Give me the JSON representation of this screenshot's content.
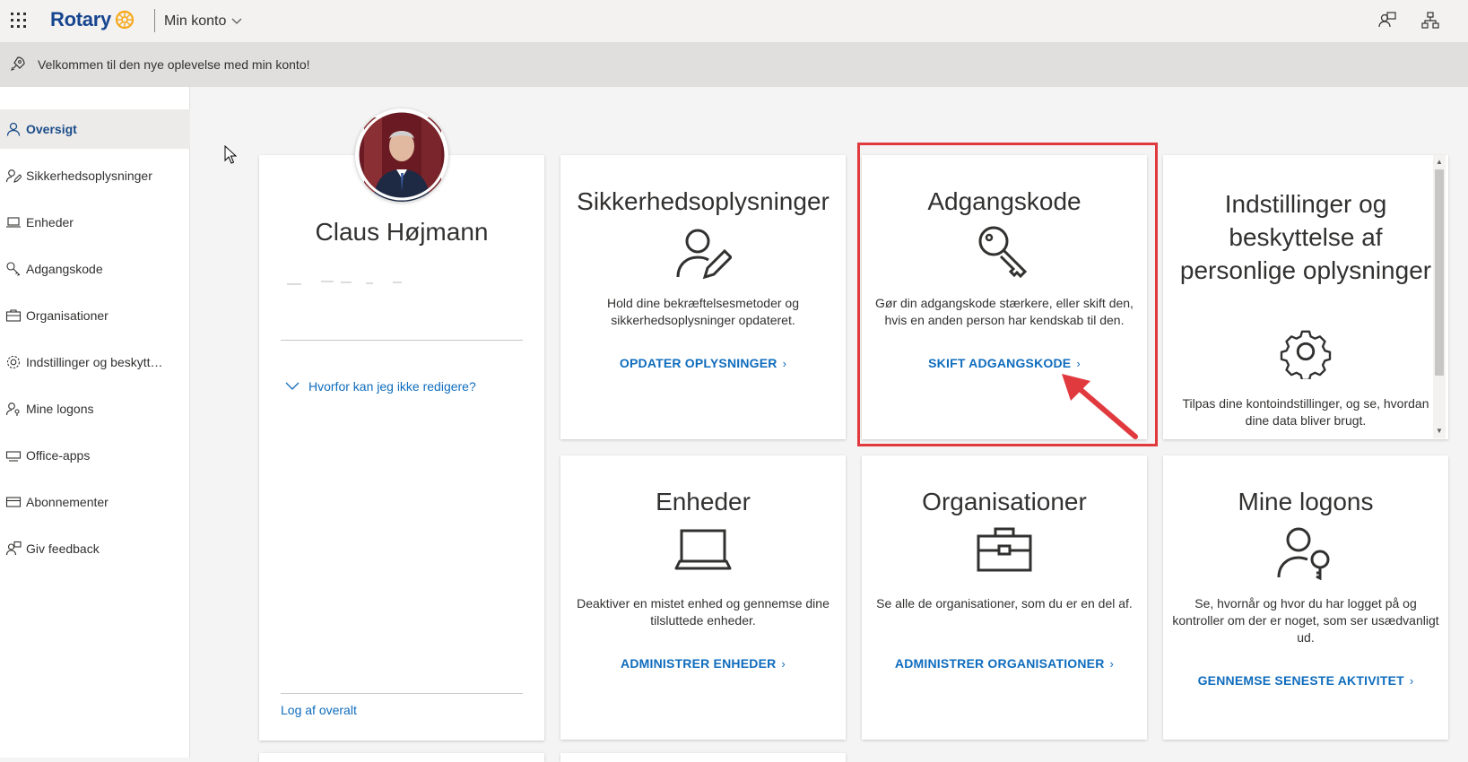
{
  "topbar": {
    "brand": "Rotary",
    "app_title": "Min konto",
    "icons": [
      "waffle-icon",
      "rotary-wheel-icon",
      "chevron-down-icon",
      "feedback-icon",
      "org-chart-icon"
    ]
  },
  "banner": {
    "text": "Velkommen til den nye oplevelse med min konto!",
    "icon": "rocket-icon"
  },
  "sidebar": {
    "items": [
      {
        "label": "Oversigt",
        "icon": "person-icon",
        "active": true
      },
      {
        "label": "Sikkerhedsoplysninger",
        "icon": "person-edit-icon"
      },
      {
        "label": "Enheder",
        "icon": "laptop-icon"
      },
      {
        "label": "Adgangskode",
        "icon": "key-icon"
      },
      {
        "label": "Organisationer",
        "icon": "briefcase-icon"
      },
      {
        "label": "Indstillinger og beskytt…",
        "icon": "gear-icon"
      },
      {
        "label": "Mine logons",
        "icon": "person-key-icon"
      },
      {
        "label": "Office-apps",
        "icon": "office-apps-icon"
      },
      {
        "label": "Abonnementer",
        "icon": "credit-card-icon"
      },
      {
        "label": "Giv feedback",
        "icon": "feedback-icon"
      }
    ]
  },
  "profile": {
    "name": "Claus Højmann",
    "why_link": "Hvorfor kan jeg ikke redigere?",
    "logout_link": "Log af overalt"
  },
  "cards": {
    "security": {
      "title": "Sikkerhedsoplysninger",
      "desc": "Hold dine bekræftelsesmetoder og sikkerhedsoplysninger opdateret.",
      "link": "OPDATER OPLYSNINGER"
    },
    "password": {
      "title": "Adgangskode",
      "desc": "Gør din adgangskode stærkere, eller skift den, hvis en anden person har kendskab til den.",
      "link": "SKIFT ADGANGSKODE"
    },
    "settings": {
      "title": "Indstillinger og beskyttelse af personlige oplysninger",
      "desc": "Tilpas dine kontoindstillinger, og se, hvordan dine data bliver brugt."
    },
    "devices": {
      "title": "Enheder",
      "desc": "Deaktiver en mistet enhed og gennemse dine tilsluttede enheder.",
      "link": "ADMINISTRER ENHEDER"
    },
    "organizations": {
      "title": "Organisationer",
      "desc": "Se alle de organisationer, som du er en del af.",
      "link": "ADMINISTRER ORGANISATIONER"
    },
    "logons": {
      "title": "Mine logons",
      "desc": "Se, hvornår og hvor du har logget på og kontroller om der er noget, som ser usædvanligt ud.",
      "link": "GENNEMSE SENESTE AKTIVITET"
    }
  },
  "colors": {
    "accent": "#0f6cbd",
    "brand": "#17458f",
    "highlight": "#e0393e",
    "rotary_gold": "#f7a81b"
  }
}
